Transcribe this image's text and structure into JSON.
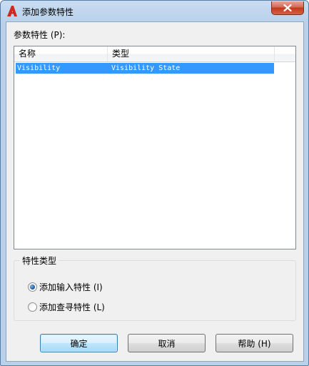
{
  "window": {
    "title": "添加参数特性",
    "close_glyph": "✕",
    "app_icon": "autocad-a-icon",
    "accent_color": "#3399ff"
  },
  "properties": {
    "label": "参数特性 (P):",
    "columns": [
      "名称",
      "类型"
    ],
    "rows": [
      {
        "name": "Visibility",
        "type": "Visibility State",
        "selected": true
      }
    ]
  },
  "property_type": {
    "title": "特性类型",
    "options": [
      {
        "label": "添加输入特性 (I)",
        "checked": true
      },
      {
        "label": "添加查寻特性 (L)",
        "checked": false
      }
    ]
  },
  "buttons": {
    "ok": "确定",
    "cancel": "取消",
    "help": "帮助 (H)"
  }
}
